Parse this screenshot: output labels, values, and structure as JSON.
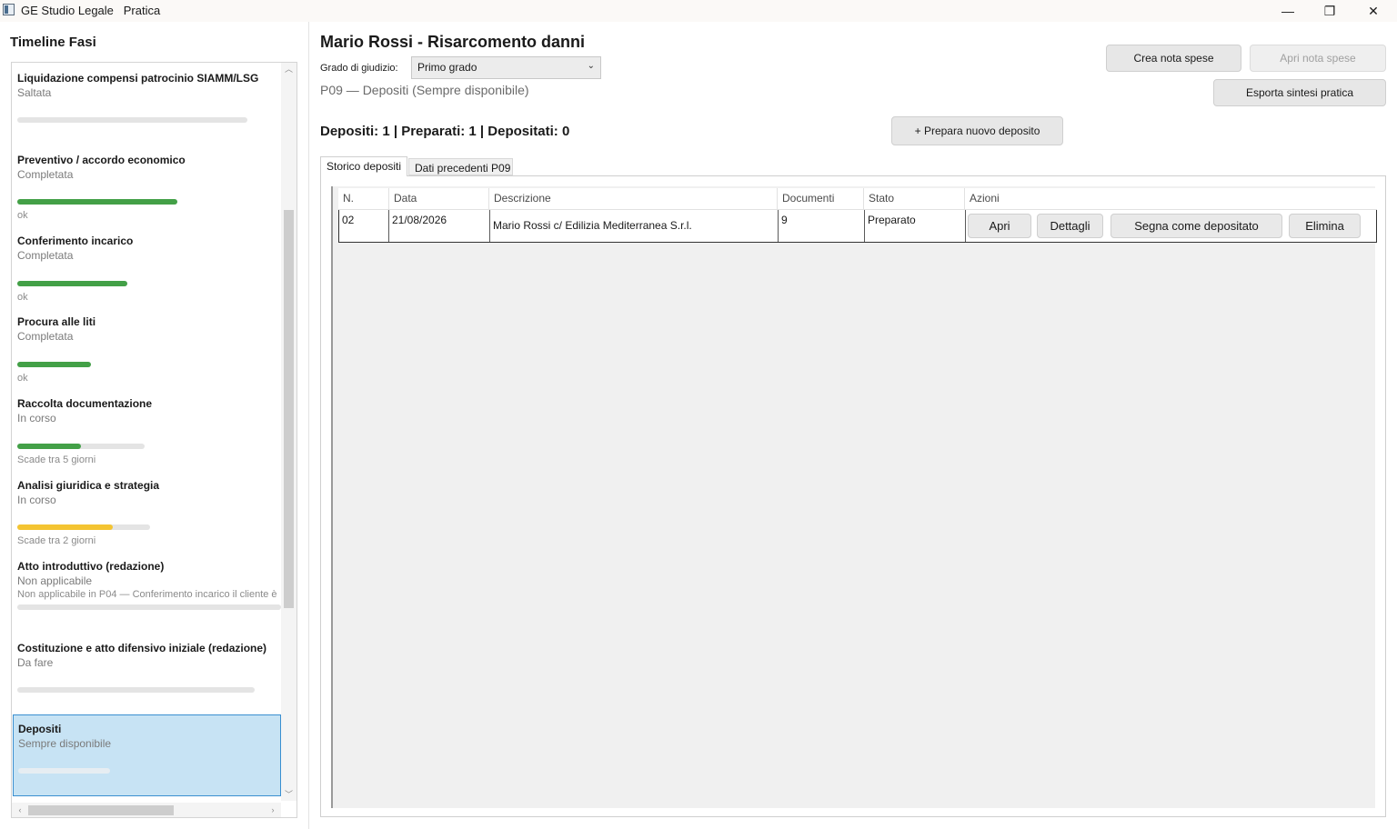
{
  "window": {
    "title": "GE Studio Legale   Pratica",
    "minimize": "—",
    "restore": "❐",
    "close": "✕"
  },
  "timeline": {
    "title": "Timeline Fasi",
    "phases": [
      {
        "name": "Liquidazione compensi patrocinio SIAMM/LSG",
        "status": "Saltata",
        "progress": 0,
        "color": "#e4e4e4",
        "note": ""
      },
      {
        "name": "Preventivo / accordo economico",
        "status": "Completata",
        "progress": 1.0,
        "color": "#43a047",
        "note": "ok"
      },
      {
        "name": "Conferimento incarico",
        "status": "Completata",
        "progress": 1.0,
        "color": "#43a047",
        "note": "ok"
      },
      {
        "name": "Procura alle liti",
        "status": "Completata",
        "progress": 1.0,
        "color": "#43a047",
        "note": "ok"
      },
      {
        "name": "Raccolta documentazione",
        "status": "In corso",
        "progress": 0.5,
        "color": "#43a047",
        "note": "Scade tra 5 giorni"
      },
      {
        "name": "Analisi giuridica e strategia",
        "status": "In corso",
        "progress": 0.72,
        "color": "#f4c431",
        "note": "Scade tra 2 giorni"
      },
      {
        "name": "Atto introduttivo (redazione)",
        "status": "Non applicabile",
        "progress": 0,
        "color": "#e4e4e4",
        "note": "Non applicabile in P04 — Conferimento incarico il cliente è"
      },
      {
        "name": "Costituzione e atto difensivo iniziale (redazione)",
        "status": "Da fare",
        "progress": 0,
        "color": "#e4e4e4",
        "note": ""
      },
      {
        "name": "Depositi",
        "status": "Sempre disponibile",
        "progress": 0,
        "color": "#e4e4e4",
        "note": ""
      }
    ]
  },
  "main": {
    "title": "Mario Rossi - Risarcomento danni",
    "grado_label": "Grado di giudizio:",
    "grado_value": "Primo grado",
    "phase_sub": "P09 — Depositi (Sempre disponibile)",
    "counts": "Depositi: 1 | Preparati: 1 | Depositati: 0",
    "buttons": {
      "crea_nota": "Crea nota spese",
      "apri_nota": "Apri nota spese",
      "esporta": "Esporta sintesi pratica",
      "prepara": "+ Prepara nuovo deposito"
    },
    "tabs": [
      "Storico depositi",
      "Dati precedenti P09"
    ],
    "table": {
      "headers": [
        "N.",
        "Data",
        "Descrizione",
        "Documenti",
        "Stato",
        "Azioni"
      ],
      "rows": [
        {
          "n": "02",
          "data": "21/08/2026",
          "descrizione": "Mario Rossi c/ Edilizia Mediterranea S.r.l.",
          "documenti": "9",
          "stato": "Preparato"
        }
      ],
      "actions": [
        "Apri",
        "Dettagli",
        "Segna come depositato",
        "Elimina"
      ]
    }
  }
}
